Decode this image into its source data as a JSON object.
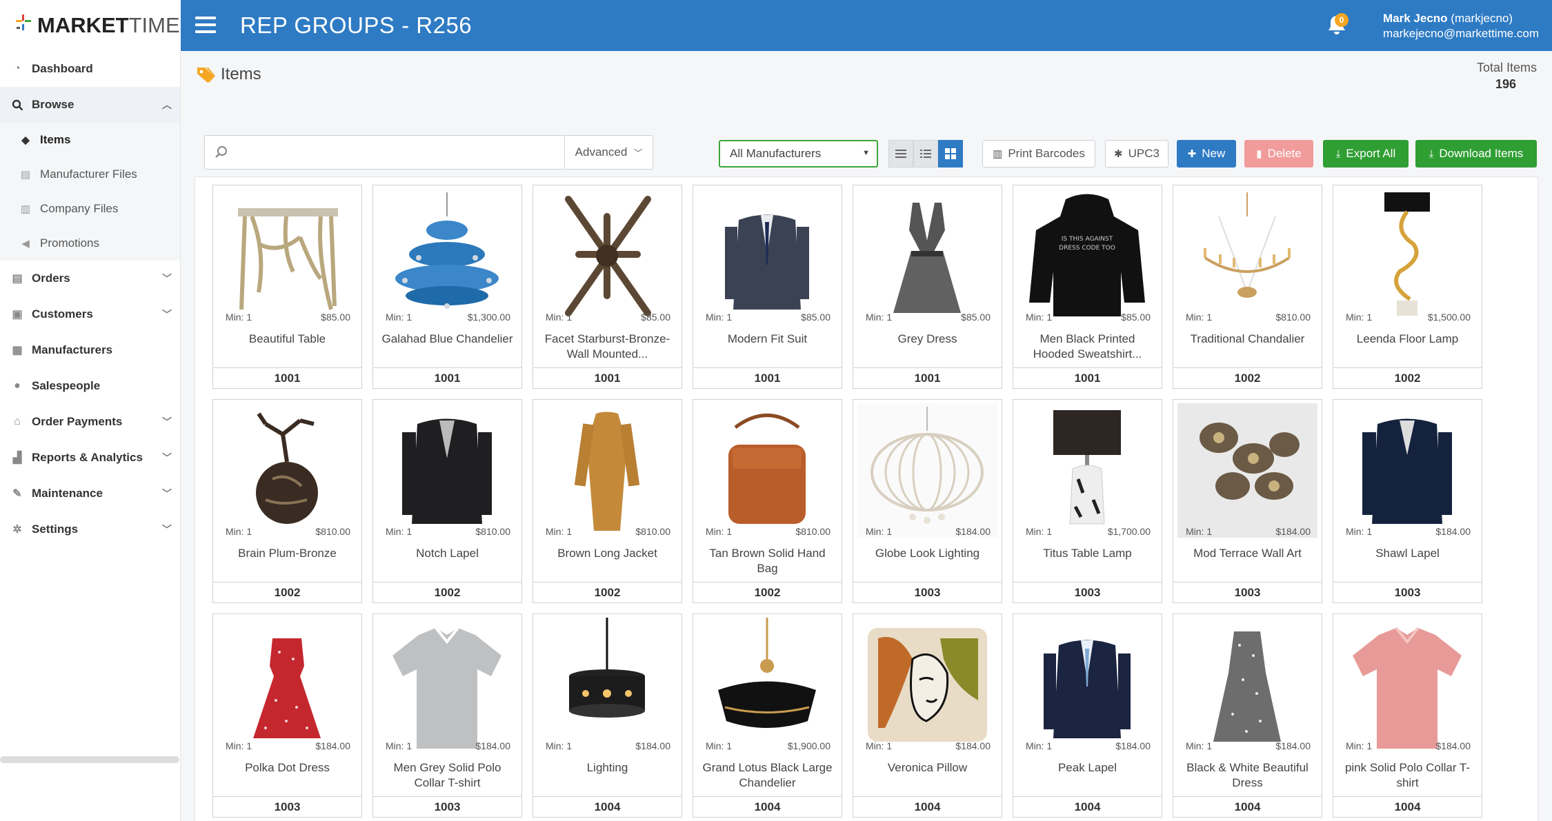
{
  "app": {
    "logo_bold": "MARKET",
    "logo_light": "TIME",
    "page_heading": "REP GROUPS - R256",
    "notifications_count": "0",
    "user_name": "Mark Jecno",
    "user_handle": "(markjecno)",
    "user_email": "markejecno@markettime.com"
  },
  "sidebar": {
    "items": [
      {
        "label": "Dashboard",
        "icon": "dashboard-icon"
      },
      {
        "label": "Browse",
        "icon": "search-icon",
        "expanded": true
      },
      {
        "label": "Orders",
        "icon": "file-icon"
      },
      {
        "label": "Customers",
        "icon": "id-card-icon"
      },
      {
        "label": "Manufacturers",
        "icon": "building-icon"
      },
      {
        "label": "Salespeople",
        "icon": "users-icon"
      },
      {
        "label": "Order Payments",
        "icon": "bank-icon"
      },
      {
        "label": "Reports & Analytics",
        "icon": "bar-chart-icon"
      },
      {
        "label": "Maintenance",
        "icon": "wrench-icon"
      },
      {
        "label": "Settings",
        "icon": "gears-icon"
      }
    ],
    "browse_sub": [
      {
        "label": "Items",
        "icon": "tags-icon",
        "current": true
      },
      {
        "label": "Manufacturer Files",
        "icon": "file-icon"
      },
      {
        "label": "Company Files",
        "icon": "files-icon"
      },
      {
        "label": "Promotions",
        "icon": "bullhorn-icon"
      }
    ]
  },
  "main": {
    "section_title": "Items",
    "total_label": "Total Items",
    "total_value": "196"
  },
  "toolbar": {
    "search_placeholder": "",
    "advanced_label": "Advanced",
    "manufacturer_selected": "All Manufacturers",
    "print_barcodes_label": "Print Barcodes",
    "upc_label": "UPC3",
    "new_label": "New",
    "delete_label": "Delete",
    "export_all_label": "Export All",
    "download_items_label": "Download Items"
  },
  "colors": {
    "header_blue": "#2e7bc4",
    "green": "#2f9e33",
    "delete_pink": "#f29b9b",
    "tag_orange": "#f5a623"
  },
  "items": [
    {
      "name": "Beautiful Table",
      "min": "Min: 1",
      "price": "$85.00",
      "code": "1001",
      "image": "table"
    },
    {
      "name": "Galahad Blue Chandelier",
      "min": "Min: 1",
      "price": "$1,300.00",
      "code": "1001",
      "image": "chandelier-blue"
    },
    {
      "name": "Facet Starburst-Bronze-Wall Mounted...",
      "min": "Min: 1",
      "price": "$85.00",
      "code": "1001",
      "image": "starburst"
    },
    {
      "name": "Modern Fit Suit",
      "min": "Min: 1",
      "price": "$85.00",
      "code": "1001",
      "image": "suit-grey"
    },
    {
      "name": "Grey Dress",
      "min": "Min: 1",
      "price": "$85.00",
      "code": "1001",
      "image": "dress-grey"
    },
    {
      "name": "Men Black Printed Hooded Sweatshirt...",
      "min": "Min: 1",
      "price": "$85.00",
      "code": "1001",
      "image": "hoodie"
    },
    {
      "name": "Traditional Chandalier",
      "min": "Min: 1",
      "price": "$810.00",
      "code": "1002",
      "image": "chandelier-gold"
    },
    {
      "name": "Leenda Floor Lamp",
      "min": "Min: 1",
      "price": "$1,500.00",
      "code": "1002",
      "image": "floor-lamp"
    },
    {
      "name": "Brain Plum-Bronze",
      "min": "Min: 1",
      "price": "$810.00",
      "code": "1002",
      "image": "bronze"
    },
    {
      "name": "Notch Lapel",
      "min": "Min: 1",
      "price": "$810.00",
      "code": "1002",
      "image": "blazer-black"
    },
    {
      "name": "Brown Long Jacket",
      "min": "Min: 1",
      "price": "$810.00",
      "code": "1002",
      "image": "jacket-brown"
    },
    {
      "name": "Tan Brown Solid Hand Bag",
      "min": "Min: 1",
      "price": "$810.00",
      "code": "1002",
      "image": "bag"
    },
    {
      "name": "Globe Look Lighting",
      "min": "Min: 1",
      "price": "$184.00",
      "code": "1003",
      "image": "globe-light"
    },
    {
      "name": "Titus Table Lamp",
      "min": "Min: 1",
      "price": "$1,700.00",
      "code": "1003",
      "image": "table-lamp"
    },
    {
      "name": "Mod Terrace Wall Art",
      "min": "Min: 1",
      "price": "$184.00",
      "code": "1003",
      "image": "wall-art"
    },
    {
      "name": "Shawl Lapel",
      "min": "Min: 1",
      "price": "$184.00",
      "code": "1003",
      "image": "blazer-navy"
    },
    {
      "name": "Polka Dot Dress",
      "min": "Min: 1",
      "price": "$184.00",
      "code": "1003",
      "image": "dress-red"
    },
    {
      "name": "Men Grey Solid Polo Collar T-shirt",
      "min": "Min: 1",
      "price": "$184.00",
      "code": "1003",
      "image": "polo-grey"
    },
    {
      "name": "Lighting",
      "min": "Min: 1",
      "price": "$184.00",
      "code": "1004",
      "image": "pendant"
    },
    {
      "name": "Grand Lotus Black Large Chandelier",
      "min": "Min: 1",
      "price": "$1,900.00",
      "code": "1004",
      "image": "lotus"
    },
    {
      "name": "Veronica Pillow",
      "min": "Min: 1",
      "price": "$184.00",
      "code": "1004",
      "image": "pillow"
    },
    {
      "name": "Peak Lapel",
      "min": "Min: 1",
      "price": "$184.00",
      "code": "1004",
      "image": "suit-navy"
    },
    {
      "name": "Black & White Beautiful Dress",
      "min": "Min: 1",
      "price": "$184.00",
      "code": "1004",
      "image": "dress-bw"
    },
    {
      "name": "pink Solid Polo Collar T-shirt",
      "min": "Min: 1",
      "price": "$184.00",
      "code": "1004",
      "image": "polo-pink"
    }
  ]
}
